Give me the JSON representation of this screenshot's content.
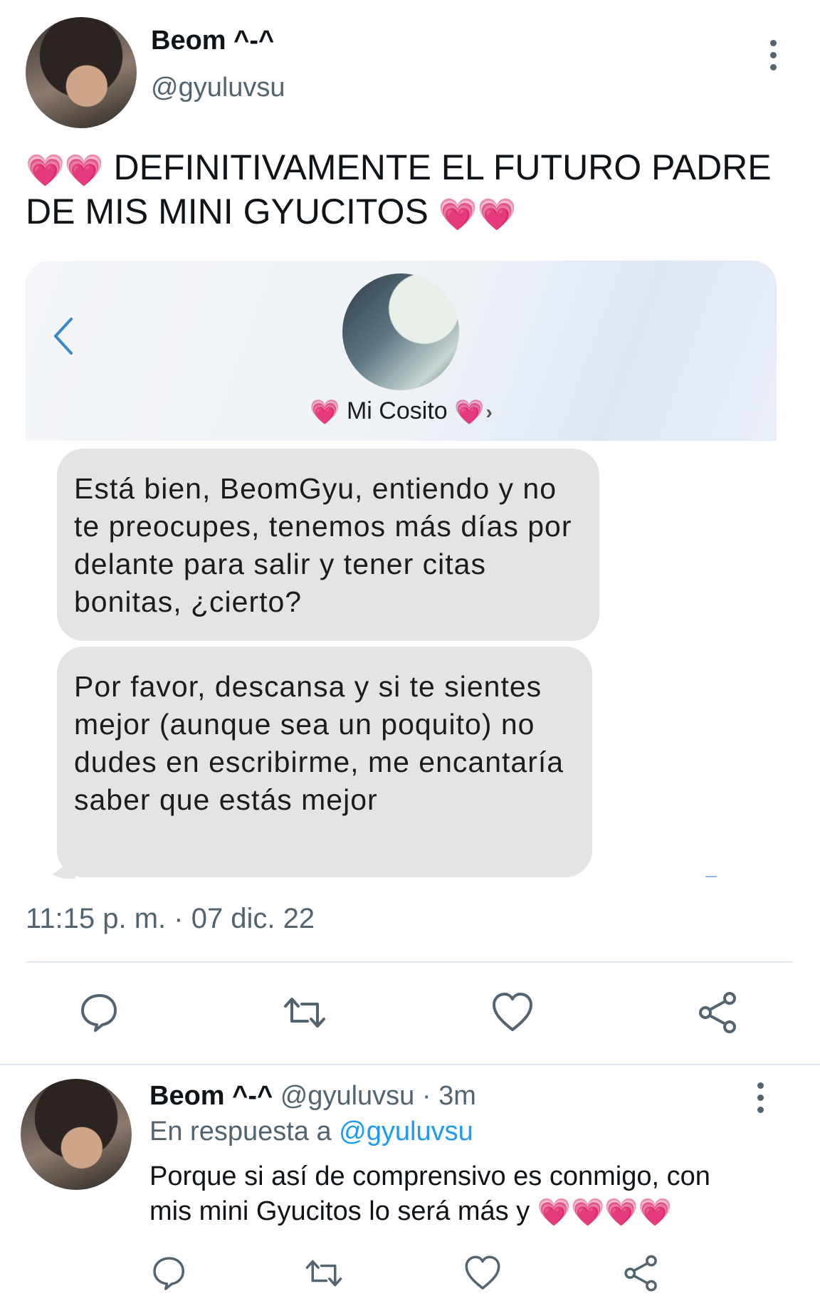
{
  "tweet": {
    "author_name": "Beom ^-^",
    "author_handle": "@gyuluvsu",
    "text_line1": "DEFINITIVAMENTE EL FUTURO PADRE",
    "text_line2": "DE MIS MINI GYUCITOS",
    "emoji": "💗💗",
    "timestamp": "11:15 p. m. · 07 dic. 22"
  },
  "screenshot": {
    "contact_name": "Mi Cosito",
    "contact_heart": "💗",
    "chevron": "›",
    "messages": [
      "Está bien, BeomGyu, entiendo y no te preocupes, tenemos más días por delante para salir y tener citas bonitas, ¿cierto?",
      "Por favor, descansa y si te sientes mejor (aunque sea un poquito) no dudes en escribirme, me encantaría saber que estás mejor"
    ]
  },
  "reply": {
    "author_name": "Beom ^-^",
    "author_handle": "@gyuluvsu",
    "time": "· 3m",
    "reply_prefix": "En respuesta a",
    "reply_mention": "@gyuluvsu",
    "text_line1": "Porque si así de comprensivo es conmigo, con",
    "text_line2": "mis mini Gyucitos lo será más y",
    "emoji": "💗💗💗💗"
  },
  "icons": {
    "reply": "reply-icon",
    "retweet": "retweet-icon",
    "like": "like-icon",
    "share": "share-icon",
    "more": "more-icon",
    "back": "back-chevron-icon"
  },
  "colors": {
    "text": "#0f1419",
    "secondary": "#536471",
    "link": "#1d9bf0",
    "bubble": "#e4e4e6",
    "heart": "#ff3fb0"
  }
}
